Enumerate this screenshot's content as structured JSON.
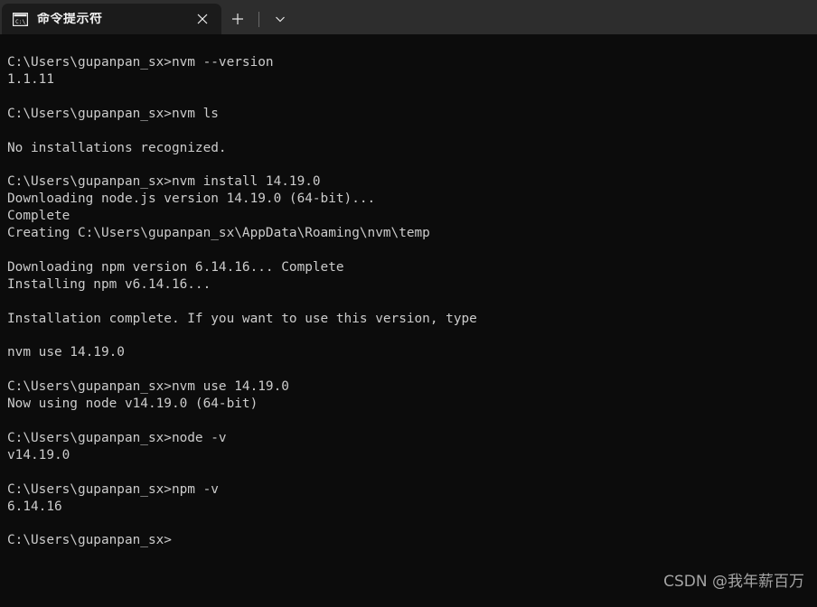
{
  "window": {
    "app_name": "Windows Terminal",
    "background_color": "#0c0c0c",
    "titlebar_color": "#2d2d2d",
    "active_tab_color": "#1b1b1b",
    "text_color": "#cccccc"
  },
  "titlebar": {
    "tabs": [
      {
        "label": "命令提示符",
        "icon": "command-prompt-icon",
        "active": true,
        "close_label": "✕"
      }
    ],
    "new_tab_label": "+",
    "dropdown_label": "⌄"
  },
  "terminal": {
    "prompt": "C:\\Users\\gupanpan_sx>",
    "lines": [
      "C:\\Users\\gupanpan_sx>nvm --version",
      "1.1.11",
      "",
      "C:\\Users\\gupanpan_sx>nvm ls",
      "",
      "No installations recognized.",
      "",
      "C:\\Users\\gupanpan_sx>nvm install 14.19.0",
      "Downloading node.js version 14.19.0 (64-bit)...",
      "Complete",
      "Creating C:\\Users\\gupanpan_sx\\AppData\\Roaming\\nvm\\temp",
      "",
      "Downloading npm version 6.14.16... Complete",
      "Installing npm v6.14.16...",
      "",
      "Installation complete. If you want to use this version, type",
      "",
      "nvm use 14.19.0",
      "",
      "C:\\Users\\gupanpan_sx>nvm use 14.19.0",
      "Now using node v14.19.0 (64-bit)",
      "",
      "C:\\Users\\gupanpan_sx>node -v",
      "v14.19.0",
      "",
      "C:\\Users\\gupanpan_sx>npm -v",
      "6.14.16",
      "",
      "C:\\Users\\gupanpan_sx>"
    ]
  },
  "watermark": {
    "text": "CSDN @我年薪百万"
  }
}
